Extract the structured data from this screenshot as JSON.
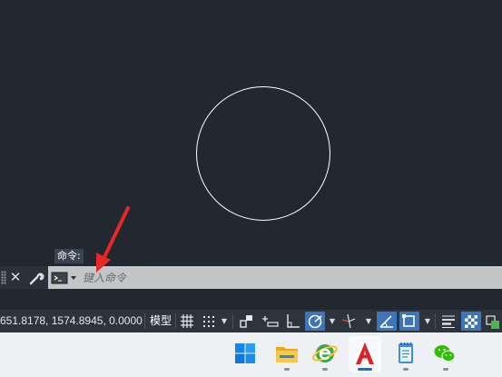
{
  "canvas": {
    "command_history_label": "命令:"
  },
  "command_line": {
    "close_glyph": "✕",
    "input_placeholder": "键入命令",
    "input_value": ""
  },
  "status_bar": {
    "coordinates": "651.8178, 1574.8945, 0.0000",
    "model_label": "模型"
  },
  "colors": {
    "canvas_bg": "#212830",
    "annotation_arrow": "#e8262a",
    "active_toggle": "#3d75b8"
  },
  "taskbar": {
    "apps": [
      {
        "name": "start-menu",
        "icon": "windows-logo-icon"
      },
      {
        "name": "file-explorer",
        "icon": "folder-icon"
      },
      {
        "name": "internet-explorer",
        "icon": "browser-e-icon"
      },
      {
        "name": "autocad",
        "icon": "autocad-a-icon",
        "active": true
      },
      {
        "name": "notepad",
        "icon": "notepad-icon"
      },
      {
        "name": "wechat",
        "icon": "wechat-icon"
      }
    ]
  }
}
